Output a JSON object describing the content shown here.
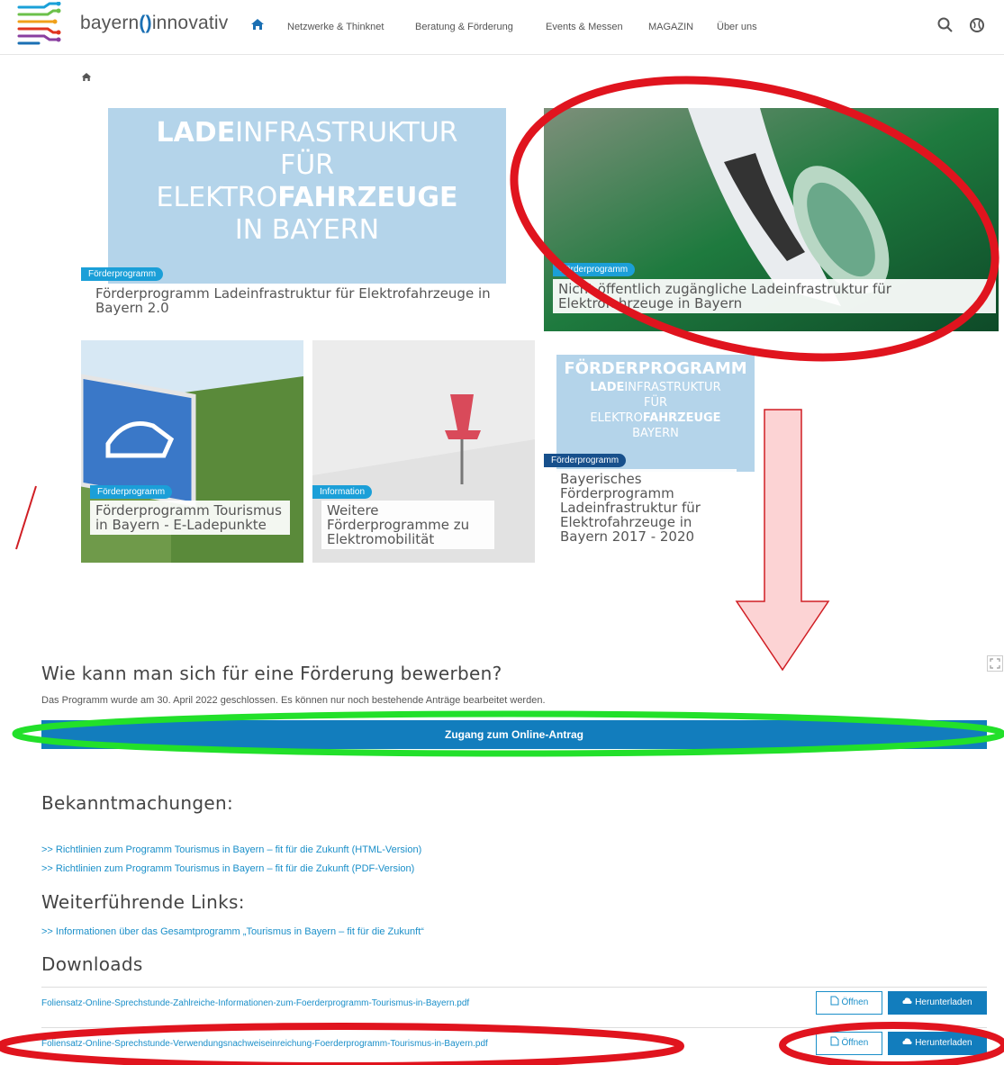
{
  "brand": {
    "name_left": "bayern",
    "name_right": "innovativ"
  },
  "nav": {
    "items": [
      "Netzwerke & Thinknet",
      "Beratung & Förderung",
      "Events & Messen",
      "MAGAZIN",
      "Über uns"
    ]
  },
  "tiles": [
    {
      "badge": "Förderprogramm",
      "title": "Förderprogramm Ladeinfrastruktur für Elektrofahrzeuge in Bayern 2.0",
      "poster": [
        "LADE",
        "INFRASTRUKTUR",
        "FÜR",
        "ELEKTRO",
        "FAHRZEUGE",
        "IN BAYERN"
      ]
    },
    {
      "badge": "Förderprogramm",
      "title": "Nicht öffentlich zugängliche Ladeinfrastruktur für Elektrofahrzeuge in Bayern"
    },
    {
      "badge": "Förderprogramm",
      "title": "Förderprogramm Tourismus in Bayern - E-Ladepunkte"
    },
    {
      "badge": "Information",
      "title": "Weitere Förderprogramme zu Elektromobilität"
    },
    {
      "badge": "Förderprogramm",
      "title": "Bayerisches Förderprogramm Ladeinfrastruktur für Elektrofahrzeuge in Bayern 2017 - 2020",
      "poster": [
        "FÖRDERPROGRAMM",
        "LADE",
        "INFRASTRUKTUR",
        "FÜR",
        "ELEKTRO",
        "FAHRZEUGE",
        "BAYERN"
      ]
    }
  ],
  "apply": {
    "heading": "Wie kann man sich für eine Förderung bewerben?",
    "notice": "Das Programm wurde am 30. April 2022 geschlossen. Es können nur noch bestehende Anträge bearbeitet werden.",
    "button": "Zugang zum Online-Antrag"
  },
  "announcements": {
    "heading": "Bekanntmachungen:",
    "links": [
      ">> Richtlinien zum Programm Tourismus in Bayern – fit für die Zukunft (HTML-Version)",
      ">> Richtlinien zum Programm Tourismus in Bayern – fit für die Zukunft (PDF-Version)"
    ]
  },
  "further": {
    "heading": "Weiterführende Links:",
    "links": [
      ">> Informationen über das Gesamtprogramm „Tourismus in Bayern – fit für die Zukunft“"
    ]
  },
  "downloads": {
    "heading": "Downloads",
    "open_label": "Öffnen",
    "download_label": "Herunterladen",
    "files": [
      "Foliensatz-Online-Sprechstunde-Zahlreiche-Informationen-zum-Foerderprogramm-Tourismus-in-Bayern.pdf",
      "Foliensatz-Online-Sprechstunde-Verwendungsnachweiseinreichung-Foerderprogramm-Tourismus-in-Bayern.pdf"
    ]
  },
  "colors": {
    "accent": "#127dbd",
    "badge": "#1b9fd8",
    "highlight_red": "#e0141e",
    "highlight_green": "#22e02a"
  },
  "icons": [
    "home-icon",
    "search-icon",
    "globe-icon",
    "pdf-icon",
    "download-cloud-icon",
    "expand-icon"
  ]
}
